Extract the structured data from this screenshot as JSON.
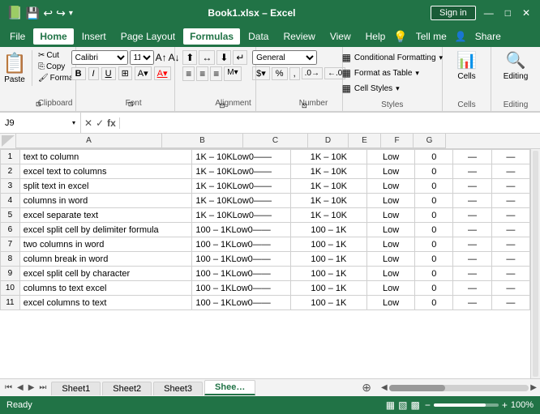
{
  "titleBar": {
    "filename": "Book1.xlsx",
    "app": "Excel",
    "signIn": "Sign in",
    "minBtn": "—",
    "maxBtn": "□",
    "closeBtn": "✕",
    "quickSave": "💾",
    "undo": "↩",
    "redo": "↪",
    "dropdown": "▾"
  },
  "menuBar": {
    "items": [
      "File",
      "Home",
      "Insert",
      "Page Layout",
      "Formulas",
      "Data",
      "Review",
      "View",
      "Help",
      "Tell me",
      "Share"
    ],
    "activeItem": "Formulas"
  },
  "ribbon": {
    "groups": [
      {
        "name": "Clipboard",
        "label": "Clipboard",
        "hasArrow": true
      },
      {
        "name": "Font",
        "label": "Font",
        "hasArrow": true
      },
      {
        "name": "Alignment",
        "label": "Alignment",
        "hasArrow": true
      },
      {
        "name": "Number",
        "label": "Number",
        "hasArrow": true
      },
      {
        "name": "Styles",
        "label": "Styles",
        "hasArrow": false,
        "items": [
          "Conditional Formatting ▾",
          "Format as Table ▾",
          "Cell Styles ▾"
        ]
      },
      {
        "name": "Cells",
        "label": "Cells",
        "hasArrow": false
      },
      {
        "name": "Editing",
        "label": "Editing",
        "hasArrow": false
      }
    ],
    "stylesItems": {
      "conditionalFormatting": "Conditional Formatting",
      "formatAsTable": "Format as Table",
      "cellStyles": "Cell Styles"
    },
    "cellsLabel": "Cells",
    "editingLabel": "Editing"
  },
  "nameBox": {
    "value": "J9"
  },
  "formulaBar": {
    "cancelIcon": "✕",
    "confirmIcon": "✓",
    "formulaIcon": "fx",
    "value": ""
  },
  "columns": [
    "A",
    "B",
    "C",
    "D",
    "E",
    "F",
    "G"
  ],
  "rows": [
    {
      "rowNum": 1,
      "a": "text to column",
      "b": "1K – 10KLow0——",
      "c": "1K – 10K",
      "d": "Low",
      "e": "0",
      "f": "—",
      "g": "—"
    },
    {
      "rowNum": 2,
      "a": "excel text to columns",
      "b": "1K – 10KLow0——",
      "c": "1K – 10K",
      "d": "Low",
      "e": "0",
      "f": "—",
      "g": "—"
    },
    {
      "rowNum": 3,
      "a": "split text in excel",
      "b": "1K – 10KLow0——",
      "c": "1K – 10K",
      "d": "Low",
      "e": "0",
      "f": "—",
      "g": "—"
    },
    {
      "rowNum": 4,
      "a": "columns in word",
      "b": "1K – 10KLow0——",
      "c": "1K – 10K",
      "d": "Low",
      "e": "0",
      "f": "—",
      "g": "—"
    },
    {
      "rowNum": 5,
      "a": "excel separate text",
      "b": "1K – 10KLow0——",
      "c": "1K – 10K",
      "d": "Low",
      "e": "0",
      "f": "—",
      "g": "—"
    },
    {
      "rowNum": 6,
      "a": "excel split cell by delimiter formula",
      "b": "100 – 1KLow0——",
      "c": "100 – 1K",
      "d": "Low",
      "e": "0",
      "f": "—",
      "g": "—"
    },
    {
      "rowNum": 7,
      "a": "two columns in word",
      "b": "100 – 1KLow0——",
      "c": "100 – 1K",
      "d": "Low",
      "e": "0",
      "f": "—",
      "g": "—"
    },
    {
      "rowNum": 8,
      "a": "column break in word",
      "b": "100 – 1KLow0——",
      "c": "100 – 1K",
      "d": "Low",
      "e": "0",
      "f": "—",
      "g": "—"
    },
    {
      "rowNum": 9,
      "a": "excel split cell by character",
      "b": "100 – 1KLow0——",
      "c": "100 – 1K",
      "d": "Low",
      "e": "0",
      "f": "—",
      "g": "—"
    },
    {
      "rowNum": 10,
      "a": "columns to text excel",
      "b": "100 – 1KLow0——",
      "c": "100 – 1K",
      "d": "Low",
      "e": "0",
      "f": "—",
      "g": "—"
    },
    {
      "rowNum": 11,
      "a": "excel columns to text",
      "b": "100 – 1KLow0——",
      "c": "100 – 1K",
      "d": "Low",
      "e": "0",
      "f": "—",
      "g": "—"
    }
  ],
  "sheets": [
    "Sheet1",
    "Sheet2",
    "Sheet3",
    "Shee…"
  ],
  "activeSheet": "Shee…",
  "statusBar": {
    "ready": "Ready",
    "zoom": "100%"
  }
}
